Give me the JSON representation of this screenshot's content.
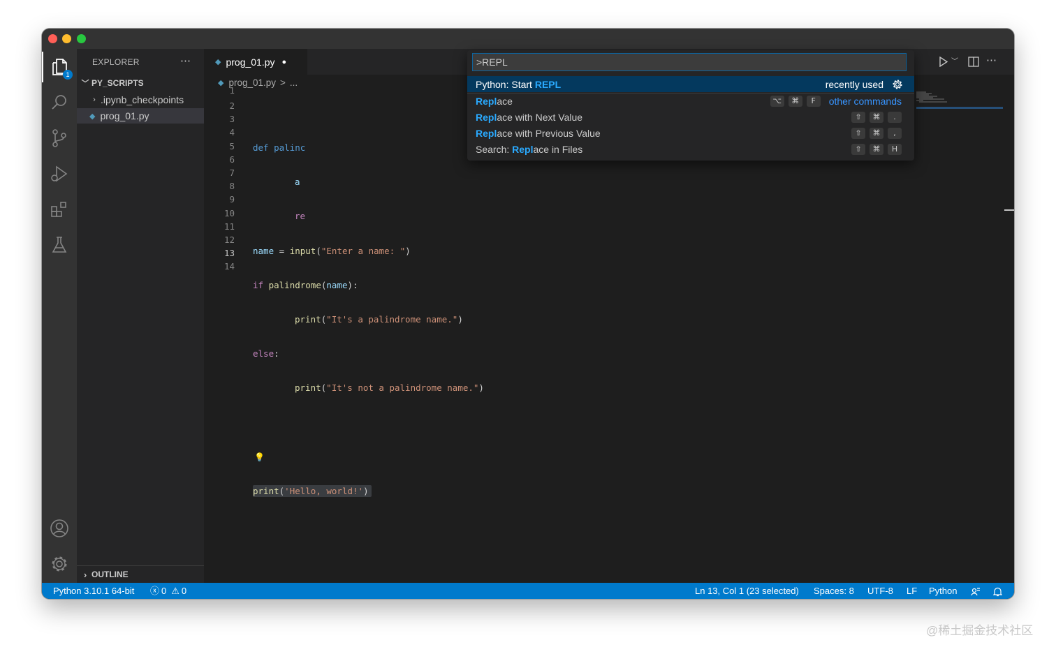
{
  "sidebar": {
    "title": "EXPLORER",
    "folder": "PY_SCRIPTS",
    "items": [
      ".ipynb_checkpoints",
      "prog_01.py"
    ],
    "outline": "OUTLINE"
  },
  "activity": {
    "explorer_badge": "1"
  },
  "tab": {
    "label": "prog_01.py",
    "modified_dot": "●"
  },
  "breadcrumb": {
    "file": "prog_01.py",
    "sep": ">",
    "more": "..."
  },
  "editor": {
    "line_numbers": [
      "1",
      "2",
      "3",
      "4",
      "5",
      "6",
      "7",
      "8",
      "9",
      "10",
      "11",
      "12",
      "13",
      "14"
    ],
    "partial": {
      "l2": "def palinc",
      "l3": "a",
      "l4": "re"
    },
    "line5": {
      "name": "name",
      "eq": " = ",
      "fn": "input",
      "p1": "(",
      "str": "\"Enter a name: \"",
      "p2": ")"
    },
    "line6": {
      "kw": "if",
      "fn": "palindrome",
      "p1": "(",
      "arg": "name",
      "p2": "):"
    },
    "line7": {
      "fn": "print",
      "p1": "(",
      "str": "\"It's a palindrome name.\"",
      "p2": ")"
    },
    "line8": {
      "kw": "else",
      "colon": ":"
    },
    "line9": {
      "fn": "print",
      "p1": "(",
      "str": "\"It's not a palindrome name.\"",
      "p2": ")"
    },
    "line12": {
      "fn": "print",
      "p1": "(",
      "str": "'Hello, world!'",
      "p2": ")"
    },
    "lightbulb": "💡"
  },
  "command_palette": {
    "input_value": ">REPL",
    "items": [
      {
        "pre": "Python: Start ",
        "hl": "REPL",
        "post": "",
        "right": "recently used"
      },
      {
        "pre": "",
        "hl": "Repl",
        "post": "ace",
        "keys": [
          "⌥",
          "⌘",
          "F"
        ],
        "right": "other commands"
      },
      {
        "pre": "",
        "hl": "Repl",
        "post": "ace with Next Value",
        "keys": [
          "⇧",
          "⌘",
          "."
        ]
      },
      {
        "pre": "",
        "hl": "Repl",
        "post": "ace with Previous Value",
        "keys": [
          "⇧",
          "⌘",
          ","
        ]
      },
      {
        "pre": "Search: ",
        "hl": "Repl",
        "post": "ace in Files",
        "keys": [
          "⇧",
          "⌘",
          "H"
        ]
      }
    ]
  },
  "statusbar": {
    "interpreter": "Python 3.10.1 64-bit",
    "errors": "0",
    "warnings": "0",
    "position": "Ln 13, Col 1 (23 selected)",
    "spaces": "Spaces: 8",
    "encoding": "UTF-8",
    "eol": "LF",
    "language": "Python"
  },
  "watermark": "@稀土掘金技术社区",
  "colors": {
    "accent": "#007acc",
    "palette_active": "#04395e",
    "highlight": "#2aaaff"
  },
  "icons": [
    "files-icon",
    "search-icon",
    "source-control-icon",
    "run-debug-icon",
    "extensions-icon",
    "testing-icon",
    "account-icon",
    "settings-gear-icon",
    "run-icon",
    "split-editor-icon",
    "more-actions-icon",
    "python-file-icon",
    "lightbulb-icon",
    "error-icon",
    "warning-icon",
    "feedback-icon",
    "bell-icon"
  ]
}
